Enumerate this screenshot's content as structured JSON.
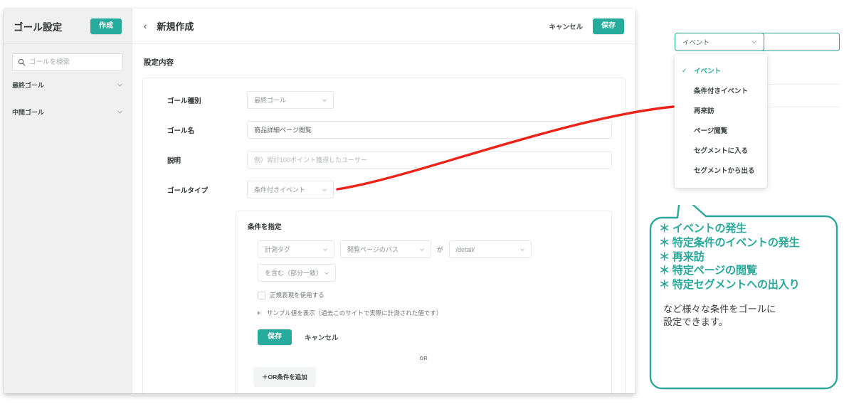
{
  "sidebar": {
    "title": "ゴール設定",
    "create_label": "作成",
    "search_placeholder": "ゴールを検索",
    "search_value": "",
    "nav_items": [
      {
        "label": "最終ゴール"
      },
      {
        "label": "中間ゴール"
      }
    ]
  },
  "main": {
    "back_icon": "‹",
    "title": "新規作成",
    "cancel_label": "キャンセル",
    "save_label": "保存",
    "section_title": "設定内容",
    "fields": {
      "goal_kind_label": "ゴール種別",
      "goal_kind_value": "最終ゴール",
      "goal_name_label": "ゴール名",
      "goal_name_value": "商品詳細ページ閲覧",
      "description_label": "説明",
      "description_placeholder": "例）累計100ポイント獲得したユーザー",
      "description_value": "",
      "goal_type_label": "ゴールタイプ",
      "goal_type_value": "条件付きイベント"
    },
    "condition": {
      "title": "条件を指定",
      "source_value": "計測タグ",
      "field_value": "閲覧ページのパス",
      "ga_label": "が",
      "target_value": "/detail/",
      "match_value": "を含む（部分一致）",
      "regex_label": "正規表現を使用する",
      "regex_checked": false,
      "sample_label": "サンプル値を表示（過去このサイトで実際に計測された値です）",
      "save_label": "保存",
      "cancel_label": "キャンセル",
      "or_label": "OR",
      "add_or_label": "＋OR条件を追加"
    }
  },
  "dropdown": {
    "selected_value": "イベント",
    "check_glyph": "✓",
    "items": [
      {
        "label": "イベント",
        "selected": true
      },
      {
        "label": "条件付きイベント",
        "selected": false
      },
      {
        "label": "再来訪",
        "selected": false
      },
      {
        "label": "ページ閲覧",
        "selected": false
      },
      {
        "label": "セグメントに入る",
        "selected": false
      },
      {
        "label": "セグメントから出る",
        "selected": false
      }
    ]
  },
  "callout": {
    "bullets": [
      "＊ イベントの発生",
      "＊ 特定条件のイベントの発生",
      "＊ 再来訪",
      "＊ 特定ページの閲覧",
      "＊ 特定セグメントへの出入り"
    ],
    "note": "など様々な条件をゴールに\n設定できます。"
  },
  "colors": {
    "accent_teal": "#27ab9c",
    "callout_teal": "#2aa89a",
    "annotation_red": "#ec2318",
    "sidebar_bg": "#eff0ef"
  }
}
